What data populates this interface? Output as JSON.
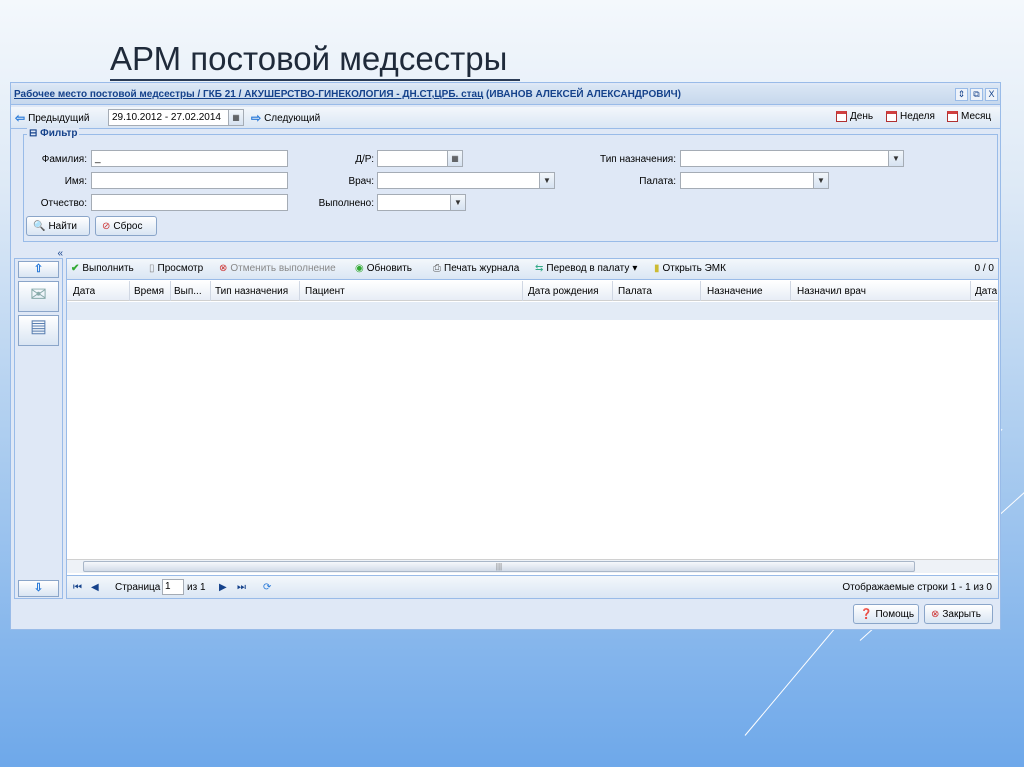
{
  "slide_title": "АРМ постовой медсестры",
  "window": {
    "title_link": "Рабочее место постовой медсестры / ГКБ 21 / АКУШЕРСТВО-ГИНЕКОЛОГИЯ - ДН.СТ,ЦРБ. стац",
    "title_user": "(ИВАНОВ АЛЕКСЕЙ АЛЕКСАНДРОВИЧ)",
    "controls": [
      "⇕",
      "⧉",
      "X"
    ]
  },
  "toolbar": {
    "prev": "Предыдущий",
    "date_range": "29.10.2012 - 27.02.2014",
    "next": "Следующий",
    "day": "День",
    "week": "Неделя",
    "month": "Месяц"
  },
  "filter": {
    "legend": "Фильтр",
    "surname_label": "Фамилия:",
    "surname_value": "_",
    "name_label": "Имя:",
    "patronymic_label": "Отчество:",
    "dob_label": "Д/Р:",
    "doctor_label": "Врач:",
    "done_label": "Выполнено:",
    "type_label": "Тип назначения:",
    "ward_label": "Палата:",
    "find": "Найти",
    "reset": "Сброс"
  },
  "grid_toolbar": {
    "execute": "Выполнить",
    "view": "Просмотр",
    "cancel": "Отменить выполнение",
    "refresh": "Обновить",
    "print": "Печать журнала",
    "transfer": "Перевод в палату",
    "open_emk": "Открыть ЭМК",
    "count": "0 / 0"
  },
  "columns": [
    "Дата",
    "Время",
    "Вып...",
    "Тип назначения",
    "Пациент",
    "Дата рождения",
    "Палата",
    "Назначение",
    "Назначил врач",
    "Дата"
  ],
  "paging": {
    "page_label": "Страница",
    "page": "1",
    "of": "из 1",
    "rows_info": "Отображаемые строки 1 - 1 из 0"
  },
  "footer": {
    "help": "Помощь",
    "close": "Закрыть"
  },
  "collapse": "«"
}
